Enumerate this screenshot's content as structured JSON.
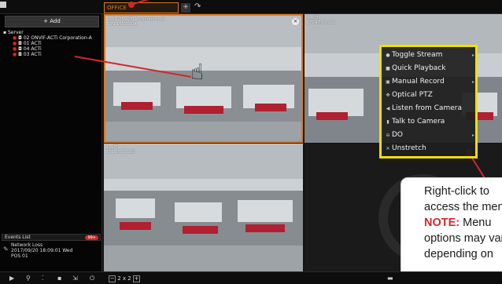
{
  "toolbar": {
    "add_label": "+ Add"
  },
  "tabs": [
    {
      "label": "OFFICE"
    },
    {
      "label": "+"
    }
  ],
  "tree": {
    "root_label": "Server",
    "items": [
      {
        "label": "02 ONVIF-ACTi Corporation-A"
      },
      {
        "label": "01 ACTi"
      },
      {
        "label": "04 ACTi"
      },
      {
        "label": "03 ACTi"
      }
    ]
  },
  "events": {
    "title": "Events List",
    "badge": "99+",
    "items": [
      {
        "type": "Network Loss",
        "time": "2017/09/20 18:09:01 Wed",
        "source": "POS 01"
      }
    ]
  },
  "cameras": [
    {
      "label": "2 ONVIF-ACTi Corporation-A9\n172.16.23.224"
    },
    {
      "label": "4 ACTi\n172.16.23.221"
    },
    {
      "label": "1 ACTi\n172.16.23.200"
    },
    {
      "label": ""
    }
  ],
  "context_menu": {
    "items": [
      {
        "label": "Toggle Stream",
        "icon": "eye-icon",
        "submenu": true
      },
      {
        "label": "Quick Playback",
        "icon": "playback-icon",
        "submenu": false
      },
      {
        "label": "Manual Record",
        "icon": "record-icon",
        "submenu": true
      },
      {
        "label": "Optical PTZ",
        "icon": "ptz-icon",
        "submenu": false
      },
      {
        "label": "Listen from Camera",
        "icon": "speaker-icon",
        "submenu": false
      },
      {
        "label": "Talk to Camera",
        "icon": "microphone-icon",
        "submenu": false
      },
      {
        "label": "DO",
        "icon": "do-icon",
        "submenu": true
      },
      {
        "label": "Unstretch",
        "icon": "unstretch-icon",
        "submenu": false
      }
    ]
  },
  "callout": {
    "text": "Right-click to access the menu.",
    "note_label": "NOTE:",
    "note_text": " Menu options may vary depending on"
  },
  "bottom_bar": {
    "layout_label": "2 x 2"
  },
  "colors": {
    "accent": "#e0791f",
    "highlight": "#f0e000",
    "annotation": "#d0282a"
  }
}
